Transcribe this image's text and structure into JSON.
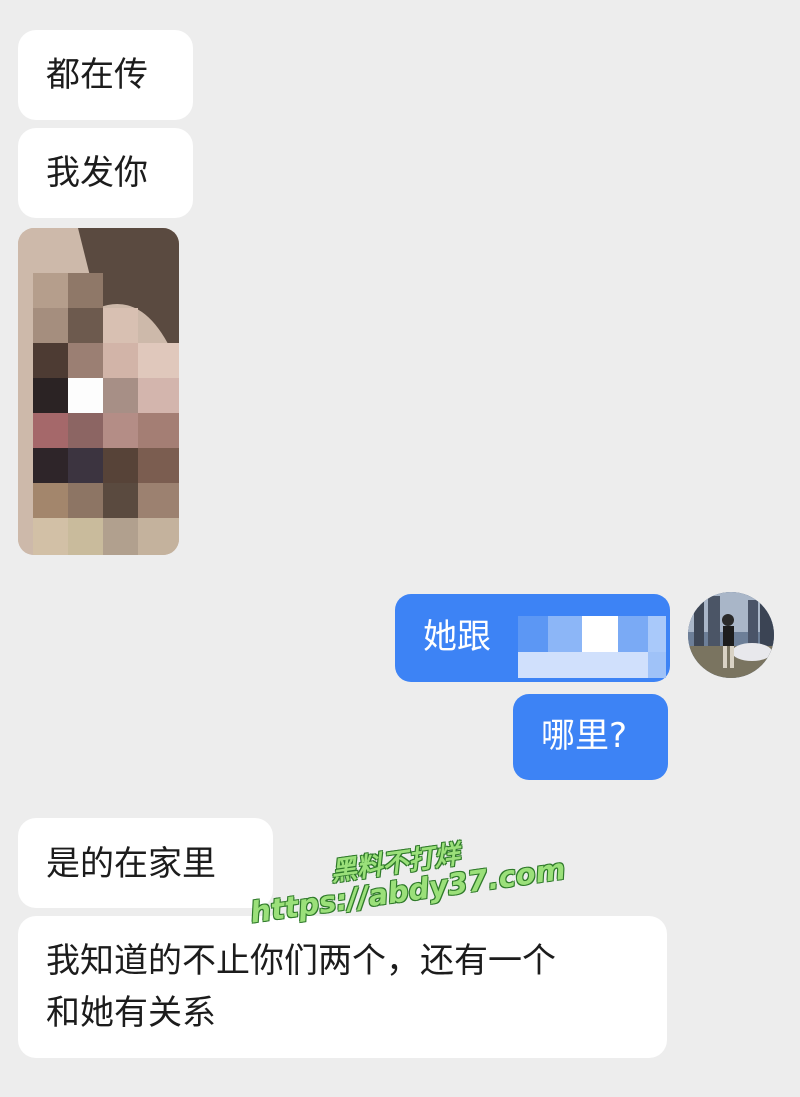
{
  "messages": {
    "m1": "都在传",
    "m2": "我发你",
    "m3_out_prefix": "她跟",
    "m4_out": "哪里?",
    "m5": "是的在家里",
    "m6_line1": "我知道的不止你们两个，还有一个",
    "m6_line2": "和她有关系"
  },
  "image_message": {
    "icon": "pixelated-photo"
  },
  "avatar": {
    "icon": "user-avatar-photo"
  },
  "watermark": {
    "line1": "黑料不打烊",
    "line2": "https://abdy37.com"
  },
  "colors": {
    "background": "#ededed",
    "incoming_bubble": "#ffffff",
    "outgoing_bubble": "#3d83f5",
    "watermark": "#9be07a"
  }
}
